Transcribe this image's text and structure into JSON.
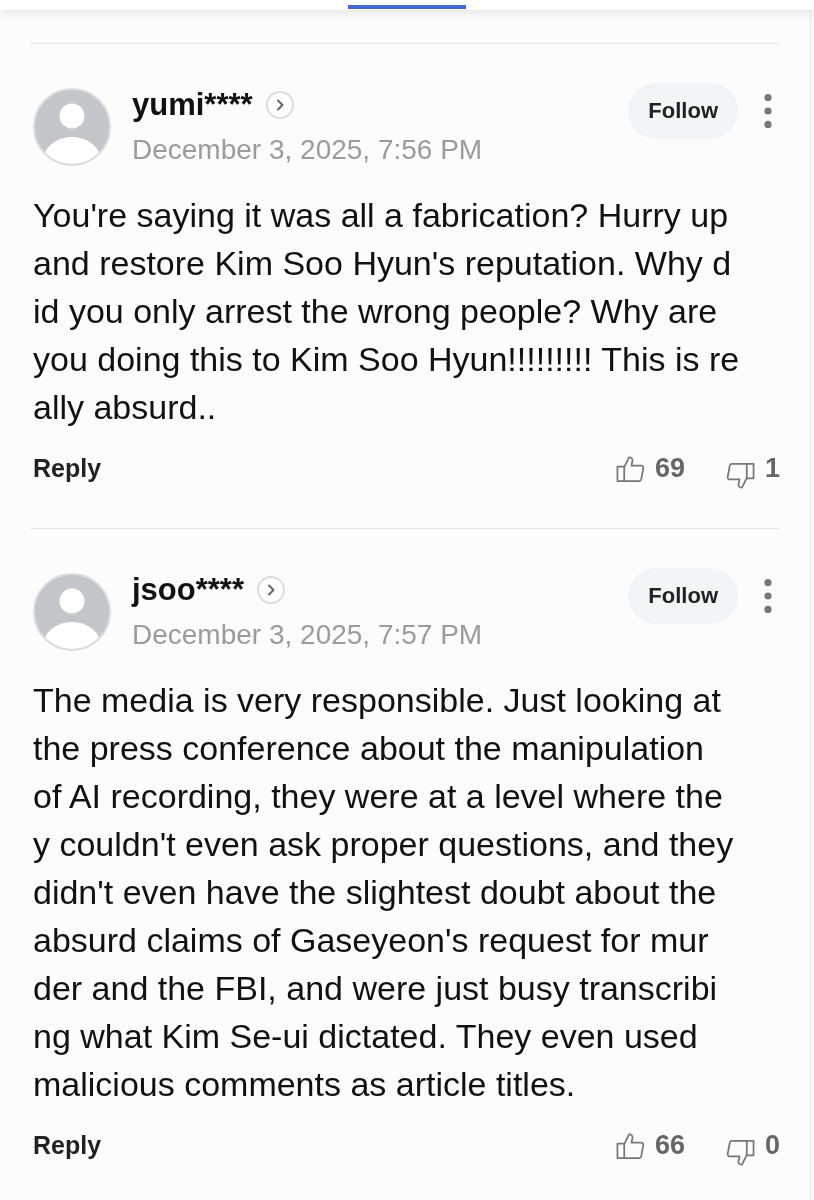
{
  "comments": [
    {
      "author": "yumi****",
      "timestamp": "December 3, 2025, 7:56 PM",
      "follow_label": "Follow",
      "text_lines": [
        "You're saying it was all a fabrication? Hurry up",
        "and restore Kim Soo Hyun's reputation. Why d",
        "id you only arrest the wrong people? Why are",
        "you doing this to Kim Soo Hyun!!!!!!!!! This is re",
        "ally absurd.."
      ],
      "reply_label": "Reply",
      "likes": "69",
      "dislikes": "1"
    },
    {
      "author": "jsoo****",
      "timestamp": "December 3, 2025, 7:57 PM",
      "follow_label": "Follow",
      "text_lines": [
        "The media is very responsible. Just looking at",
        "the press conference about the manipulation",
        "of AI recording, they were at a level where the",
        "y couldn't even ask proper questions, and they",
        "didn't even have the slightest doubt about the",
        "absurd claims of Gaseyeon's request for mur",
        "der and the FBI, and were just busy transcribi",
        "ng what Kim Se-ui dictated. They even used",
        "malicious comments as article titles."
      ],
      "reply_label": "Reply",
      "likes": "66",
      "dislikes": "0"
    }
  ]
}
